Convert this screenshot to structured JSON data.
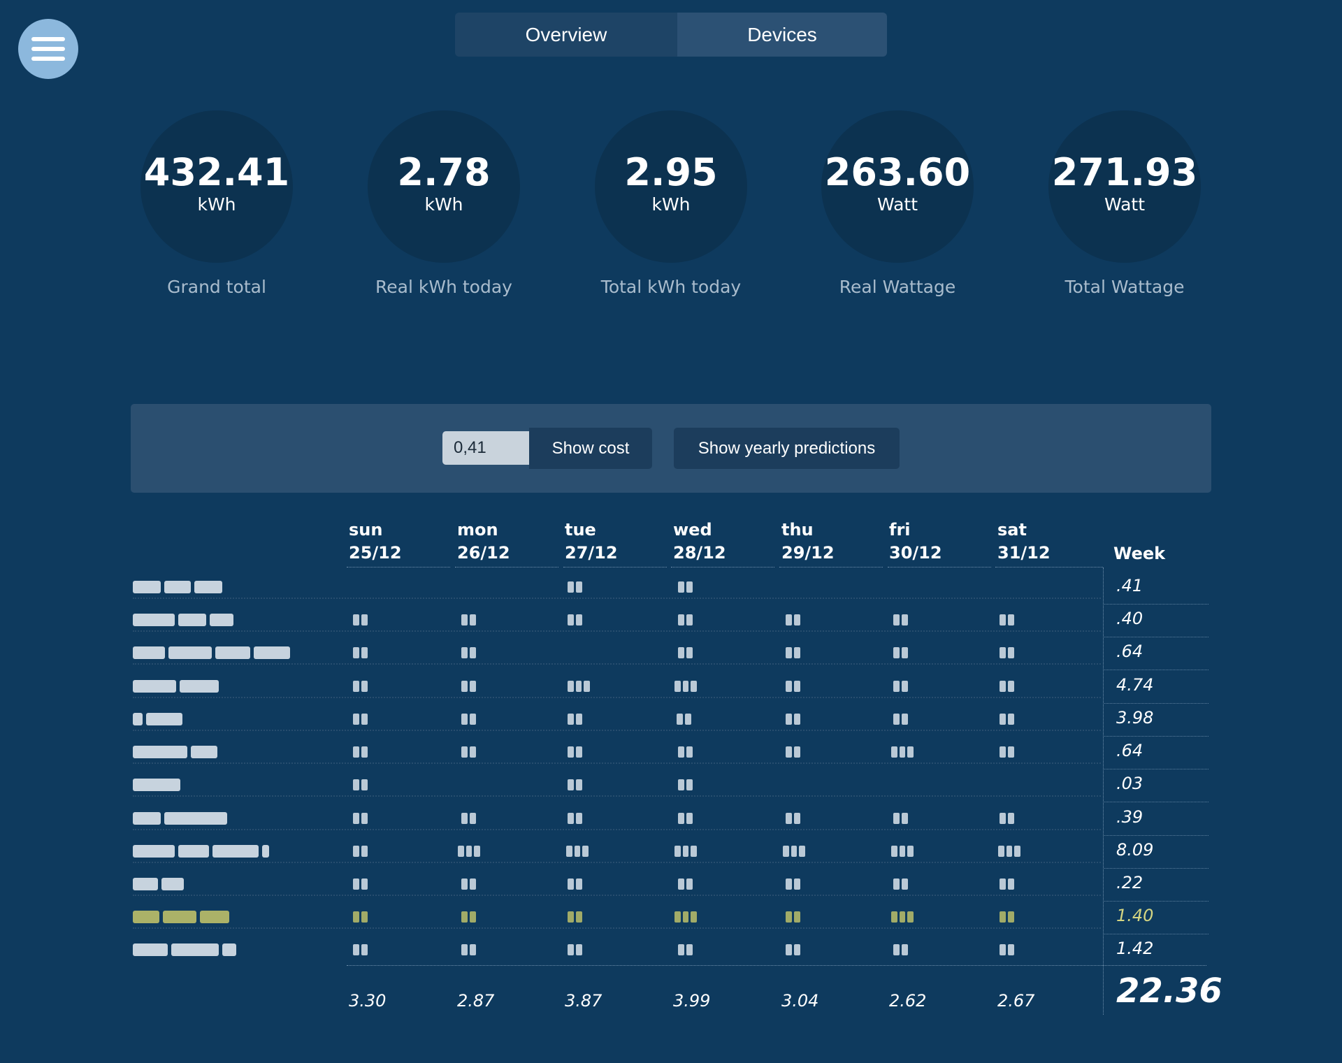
{
  "tabs": [
    {
      "label": "Overview",
      "active": true
    },
    {
      "label": "Devices",
      "active": false
    }
  ],
  "stats": [
    {
      "value": "432.41",
      "unit": "kWh",
      "label": "Grand total"
    },
    {
      "value": "2.78",
      "unit": "kWh",
      "label": "Real kWh today"
    },
    {
      "value": "2.95",
      "unit": "kWh",
      "label": "Total kWh today"
    },
    {
      "value": "263.60",
      "unit": "Watt",
      "label": "Real Wattage"
    },
    {
      "value": "271.93",
      "unit": "Watt",
      "label": "Total Wattage"
    }
  ],
  "cost_panel": {
    "price_value": "0,41",
    "show_cost_label": "Show cost",
    "yearly_label": "Show yearly predictions"
  },
  "table": {
    "days": [
      {
        "dow": "sun",
        "date": "25/12"
      },
      {
        "dow": "mon",
        "date": "26/12"
      },
      {
        "dow": "tue",
        "date": "27/12"
      },
      {
        "dow": "wed",
        "date": "28/12"
      },
      {
        "dow": "thu",
        "date": "29/12"
      },
      {
        "dow": "fri",
        "date": "30/12"
      },
      {
        "dow": "sat",
        "date": "31/12"
      }
    ],
    "week_header": "Week",
    "week_values": [
      ".41",
      ".40",
      ".64",
      "4.74",
      "3.98",
      ".64",
      ".03",
      ".39",
      "8.09",
      ".22",
      "1.40",
      "1.42"
    ],
    "day_totals": [
      "3.30",
      "2.87",
      "3.87",
      "3.99",
      "3.04",
      "2.62",
      "2.67"
    ],
    "week_total": "22.36",
    "highlight_color": "#c7c86a"
  }
}
